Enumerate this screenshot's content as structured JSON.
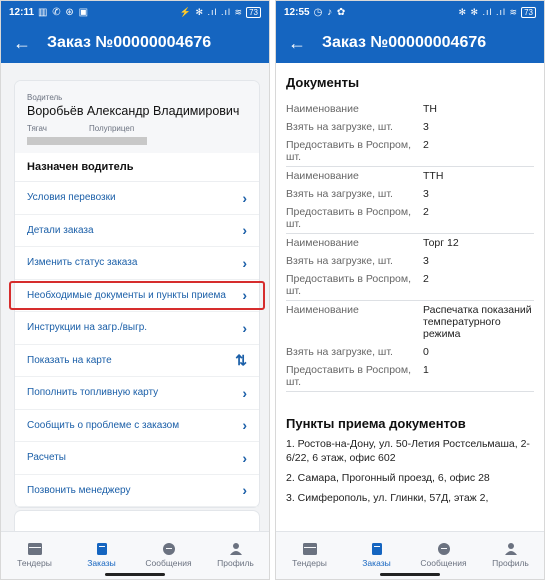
{
  "left": {
    "status_time": "12:11",
    "status_icons": "▥ ✆ ⊛ ▣",
    "status_right": "⚡ ✻ .ıl .ıl ≋",
    "battery": "73",
    "title": "Заказ №00000004676",
    "driver_label": "Водитель",
    "driver_name": "Воробьёв Александр Владимирович",
    "tractor_label": "Тягач",
    "trailer_label": "Полуприцеп",
    "assigned": "Назначен водитель",
    "menu": [
      "Условия перевозки",
      "Детали заказа",
      "Изменить статус заказа",
      "Необходимые документы и пункты приема",
      "Инструкции на загр./выгр.",
      "Показать на карте",
      "Пополнить топливную карту",
      "Сообщить о проблеме с заказом",
      "Расчеты",
      "Позвонить менеджеру"
    ]
  },
  "right": {
    "status_time": "12:55",
    "status_icons": "◷ ♪ ✿",
    "status_right": "✻ ✻ .ıl .ıl ≋",
    "battery": "73",
    "title": "Заказ №00000004676",
    "section_docs": "Документы",
    "docs": [
      {
        "name_label": "Наименование",
        "name": "ТН",
        "take_label": "Взять на загрузке, шт.",
        "take": "3",
        "give_label": "Предоставить в Роспром, шт.",
        "give": "2"
      },
      {
        "name_label": "Наименование",
        "name": "ТТН",
        "take_label": "Взять на загрузке, шт.",
        "take": "3",
        "give_label": "Предоставить в Роспром, шт.",
        "give": "2"
      },
      {
        "name_label": "Наименование",
        "name": "Торг 12",
        "take_label": "Взять на загрузке, шт.",
        "take": "3",
        "give_label": "Предоставить в Роспром, шт.",
        "give": "2"
      },
      {
        "name_label": "Наименование",
        "name": "Распечатка показаний температурного режима",
        "take_label": "Взять на загрузке, шт.",
        "take": "0",
        "give_label": "Предоставить в Роспром, шт.",
        "give": "1"
      }
    ],
    "section_points": "Пункты приема документов",
    "points": [
      "1. Ростов-на-Дону, ул. 50-Летия Ростсельмаша, 2-6/22, 6 этаж, офис 602",
      "2. Самара, Прогонный проезд, 6, офис 28",
      "3. Симферополь, ул. Глинки, 57Д, этаж 2,"
    ]
  },
  "nav": {
    "tenders": "Тендеры",
    "orders": "Заказы",
    "messages": "Сообщения",
    "profile": "Профиль"
  },
  "colors": {
    "primary": "#1565c0",
    "highlight": "#d62d2d"
  }
}
